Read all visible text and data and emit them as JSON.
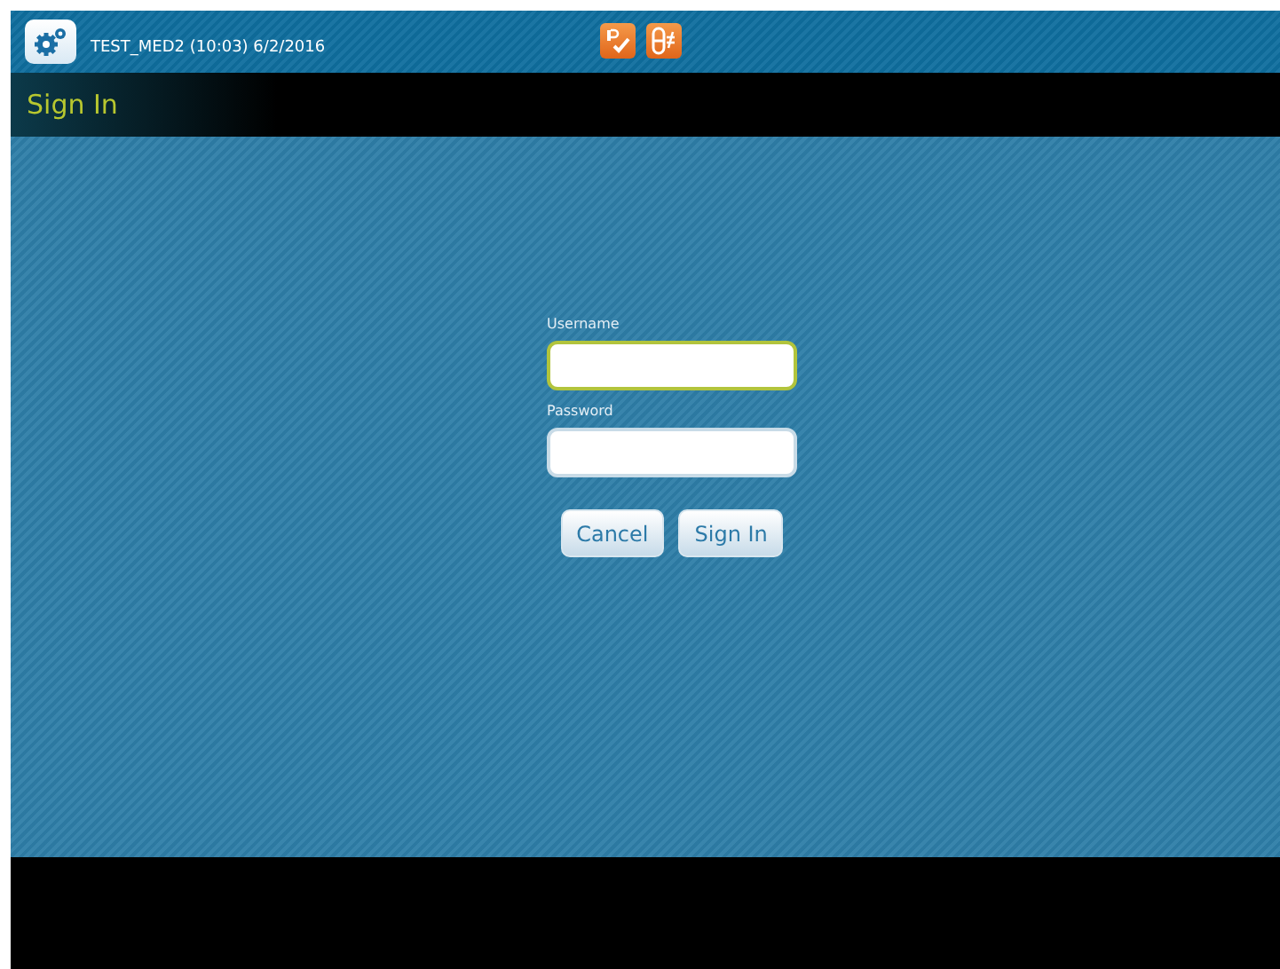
{
  "header": {
    "session": "TEST_MED2 (10:03) 6/2/2016"
  },
  "title_bar": {
    "title": "Sign In"
  },
  "form": {
    "fields": [
      {
        "label": "Username",
        "focused": true
      },
      {
        "label": "Password",
        "focused": false
      }
    ],
    "buttons": [
      "Cancel",
      "Sign In"
    ]
  }
}
